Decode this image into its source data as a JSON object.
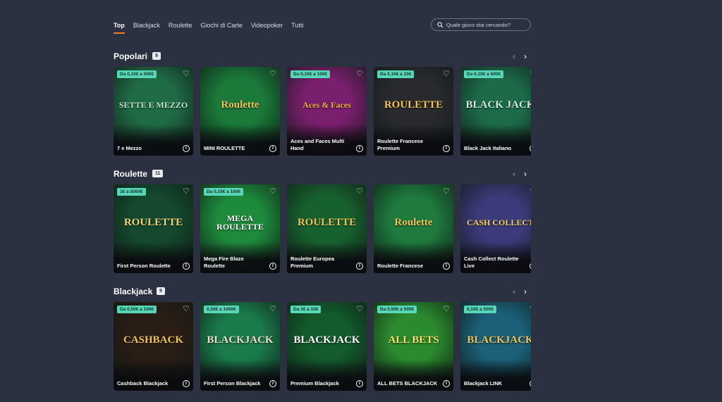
{
  "nav": {
    "tabs": [
      "Top",
      "Blackjack",
      "Roulette",
      "Giochi di Carte",
      "Videopoker",
      "Tutti"
    ],
    "active_tab": "Top",
    "search_placeholder": "Quale gioco stai cercando?",
    "search_icon": "search-icon"
  },
  "sections": [
    {
      "title": "Popolari",
      "count": "9",
      "games": [
        {
          "name": "7 e Mezzo",
          "bet": "Da 0,10€ a 500€",
          "art_text": "SETTE E MEZZO",
          "bg": "#1f6b45",
          "art_color": "#bfe8cf"
        },
        {
          "name": "MINI ROULETTE",
          "bet": "",
          "art_text": "Roulette",
          "bg": "#1b7a3a",
          "art_color": "#f0c35a"
        },
        {
          "name": "Aces and Faces Multi Hand",
          "bet": "Da 0,10€ a 100€",
          "art_text": "Aces & Faces",
          "bg": "#7a1e6e",
          "art_color": "#f3b33d"
        },
        {
          "name": "Roulette Francese Premium",
          "bet": "Da 0,10€ a 10€",
          "art_text": "ROULETTE",
          "bg": "#2a2a2e",
          "art_color": "#f0c35a"
        },
        {
          "name": "Black Jack Italiano",
          "bet": "Da 0,10€ a 500€",
          "art_text": "BLACK JACK",
          "bg": "#1c6a48",
          "art_color": "#cfeedd"
        }
      ]
    },
    {
      "title": "Roulette",
      "count": "11",
      "games": [
        {
          "name": "First Person Roulette",
          "bet": "1€ a 5000€",
          "art_text": "ROULETTE",
          "bg": "#14492d",
          "art_color": "#f0d27a"
        },
        {
          "name": "Mega Fire Blaze Roulette",
          "bet": "Da 0,10€ a 100€",
          "art_text": "MEGA ROULETTE",
          "bg": "#1e8a3c",
          "art_color": "#ffffff"
        },
        {
          "name": "Roulette Europea Premium",
          "bet": "",
          "art_text": "ROULETTE",
          "bg": "#17612f",
          "art_color": "#f0c35a"
        },
        {
          "name": "Roulette Francese",
          "bet": "",
          "art_text": "Roulette",
          "bg": "#1e7a3e",
          "art_color": "#f0c35a"
        },
        {
          "name": "Cash Collect Roulette Live",
          "bet": "",
          "art_text": "CASH COLLECT",
          "bg": "#3b3a7a",
          "art_color": "#f5d35c"
        }
      ]
    },
    {
      "title": "Blackjack",
      "count": "9",
      "games": [
        {
          "name": "Cashback Blackjack",
          "bet": "Da 0,50€ a 100€",
          "art_text": "CASHBACK",
          "bg": "#2a1d14",
          "art_color": "#f0c35a"
        },
        {
          "name": "First Person Blackjack",
          "bet": "0,50€ a 1000€",
          "art_text": "BLACKJACK",
          "bg": "#1a7a4a",
          "art_color": "#e8e0c8"
        },
        {
          "name": "Premium Blackjack",
          "bet": "Da 1€ a 10€",
          "art_text": "BLACKJACK",
          "bg": "#135a2c",
          "art_color": "#ffffff"
        },
        {
          "name": "ALL BETS BLACKJACK",
          "bet": "Da 0,50€ a 500€",
          "art_text": "ALL BETS",
          "bg": "#2b8a2f",
          "art_color": "#f5e46a"
        },
        {
          "name": "Blackjack LINK",
          "bet": "0,10€ a 500€",
          "art_text": "BLACKJACK",
          "bg": "#1b5f78",
          "art_color": "#f0c35a"
        }
      ]
    }
  ],
  "icons": {
    "favorite": "heart-icon",
    "info": "info-icon",
    "prev": "chevron-left-icon",
    "next": "chevron-right-icon"
  }
}
